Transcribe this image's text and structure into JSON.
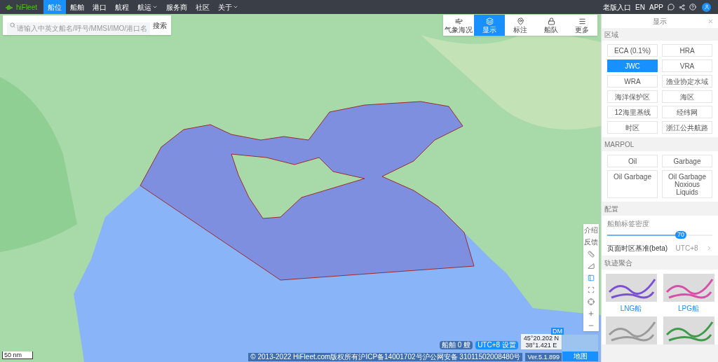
{
  "header": {
    "logo": "hiFleet",
    "nav": [
      {
        "label": "船位",
        "selected": true,
        "dropdown": false
      },
      {
        "label": "船舶",
        "selected": false,
        "dropdown": false
      },
      {
        "label": "港口",
        "selected": false,
        "dropdown": false
      },
      {
        "label": "航程",
        "selected": false,
        "dropdown": false
      },
      {
        "label": "航运",
        "selected": false,
        "dropdown": true
      },
      {
        "label": "服务商",
        "selected": false,
        "dropdown": false
      },
      {
        "label": "社区",
        "selected": false,
        "dropdown": false
      },
      {
        "label": "关于",
        "selected": false,
        "dropdown": true
      }
    ],
    "links": [
      "老版入口",
      "EN",
      "APP"
    ]
  },
  "search": {
    "placeholder": "请输入中英文船名/呼号/MMSI/IMO/港口名",
    "button": "搜索"
  },
  "toolbar": [
    {
      "label": "气象海况",
      "selected": false
    },
    {
      "label": "显示",
      "selected": true
    },
    {
      "label": "标注",
      "selected": false
    },
    {
      "label": "船队",
      "selected": false
    },
    {
      "label": "更多",
      "selected": false
    }
  ],
  "panel": {
    "title": "显示",
    "zones": {
      "heading": "区域",
      "options": [
        {
          "label": "ECA (0.1%)",
          "selected": false
        },
        {
          "label": "HRA",
          "selected": false
        },
        {
          "label": "JWC",
          "selected": true
        },
        {
          "label": "VRA",
          "selected": false
        },
        {
          "label": "WRA",
          "selected": false
        },
        {
          "label": "渔业协定水域",
          "selected": false
        },
        {
          "label": "海洋保护区",
          "selected": false
        },
        {
          "label": "海区",
          "selected": false
        },
        {
          "label": "12海里基线",
          "selected": false
        },
        {
          "label": "经纬网",
          "selected": false
        },
        {
          "label": "时区",
          "selected": false
        },
        {
          "label": "浙江公共航路",
          "selected": false
        }
      ]
    },
    "marpol": {
      "heading": "MARPOL",
      "options": [
        {
          "label": "Oil",
          "selected": false
        },
        {
          "label": "Garbage",
          "selected": false
        },
        {
          "label": "Oil Garbage",
          "selected": false
        },
        {
          "label": "Oil Garbage Noxious Liquids",
          "selected": false
        }
      ]
    },
    "config": {
      "heading": "配置",
      "density": {
        "label": "船舶标签密度",
        "level": 0.7,
        "reading": "70"
      },
      "timezone": {
        "label": "页面时区基准(beta)",
        "value": "UTC+8"
      }
    },
    "tracks": {
      "heading": "轨迹聚合",
      "cards": [
        {
          "label": "LNG船",
          "color": "#7b4fd6"
        },
        {
          "label": "LPG船",
          "color": "#d64fa8"
        },
        {
          "color": "#9a9a9a"
        },
        {
          "color": "#3f9a4a"
        }
      ]
    }
  },
  "map_controls": {
    "labels": [
      "介绍",
      "反馈"
    ],
    "tools": [
      {
        "kind": "ruler",
        "selected": false
      },
      {
        "kind": "angle",
        "selected": false
      },
      {
        "kind": "layout",
        "selected": true
      },
      {
        "kind": "fit",
        "selected": false
      },
      {
        "kind": "locate",
        "selected": false
      },
      {
        "kind": "zoom-in",
        "selected": false
      },
      {
        "kind": "zoom-out",
        "selected": false
      }
    ]
  },
  "status": {
    "ships": "船舶 0 艘",
    "timezone": "UTC+8 设置",
    "latitude": "45°20.202 N",
    "longitude": "38°1.421 E",
    "format": "DM",
    "basemap": "地图",
    "copyright": "© 2013-2022 HiFleet.com版权所有沪ICP备14001702号沪公网安备 31011502008480号",
    "version": "Ver.5.1.899",
    "scale": "50 nm"
  }
}
